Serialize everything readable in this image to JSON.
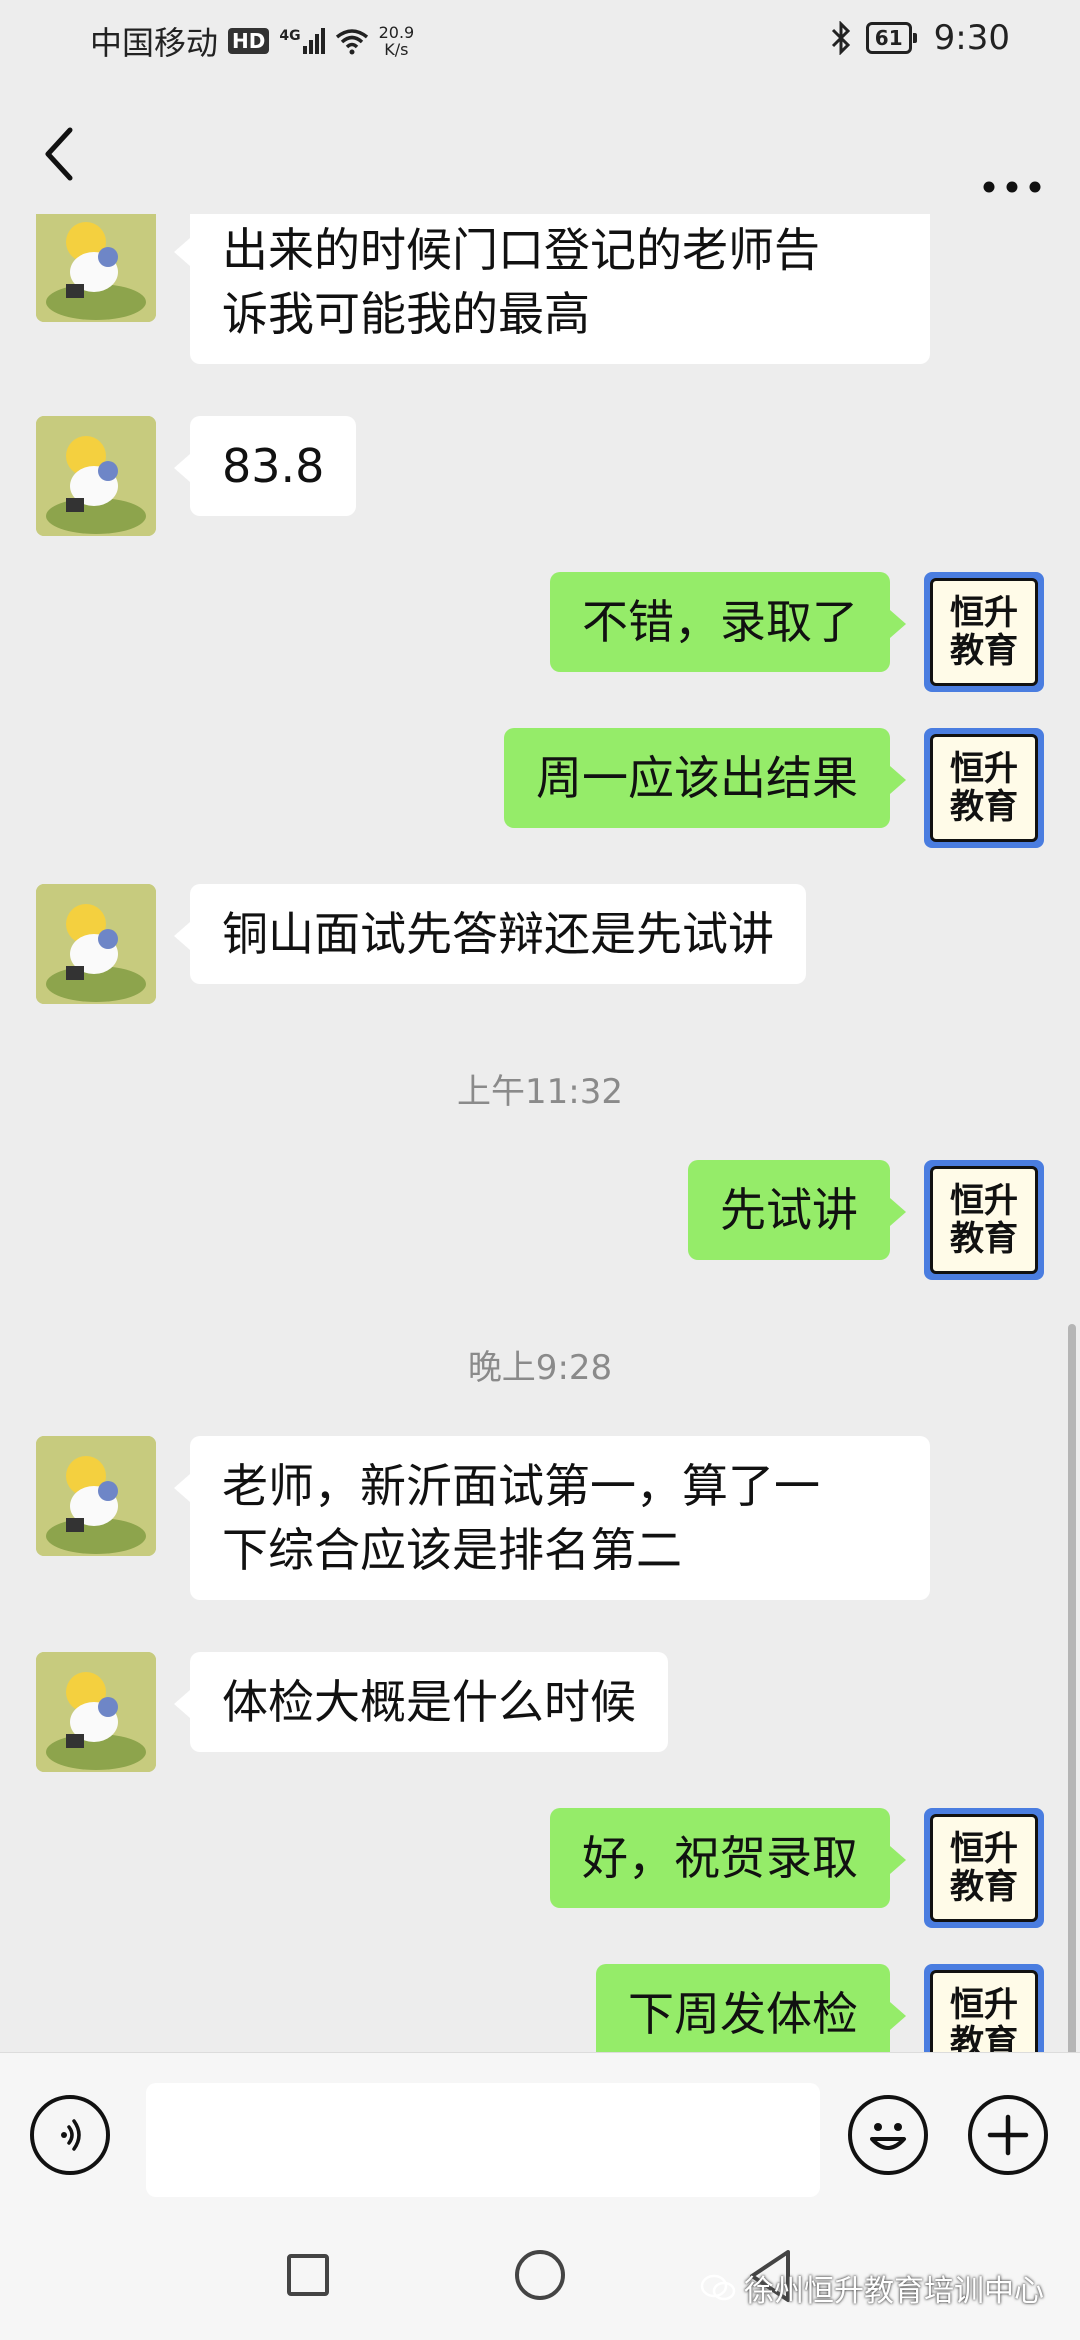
{
  "status_bar": {
    "carrier": "中国移动",
    "hd": "HD",
    "network": "4G",
    "speed_value": "20.9",
    "speed_unit": "K/s",
    "battery": "61",
    "time": "9:30"
  },
  "messages": [
    {
      "side": "left",
      "text_lines": [
        "出来的时候门口登记的老师告",
        "诉我可能我的最高"
      ]
    },
    {
      "side": "left",
      "text_lines": [
        "83.8"
      ]
    },
    {
      "side": "right",
      "text_lines": [
        "不错，录取了"
      ]
    },
    {
      "side": "right",
      "text_lines": [
        "周一应该出结果"
      ]
    },
    {
      "side": "left",
      "text_lines": [
        "铜山面试先答辩还是先试讲"
      ]
    },
    {
      "timestamp": "上午11:32"
    },
    {
      "side": "right",
      "text_lines": [
        "先试讲"
      ]
    },
    {
      "timestamp": "晚上9:28"
    },
    {
      "side": "left",
      "text_lines": [
        "老师，新沂面试第一，算了一",
        "下综合应该是排名第二"
      ]
    },
    {
      "side": "left",
      "text_lines": [
        "体检大概是什么时候"
      ]
    },
    {
      "side": "right",
      "text_lines": [
        "好，祝贺录取"
      ]
    },
    {
      "side": "right",
      "text_lines": [
        "下周发体检"
      ]
    }
  ],
  "logo_avatar": {
    "line1": "恒升",
    "line2": "教育"
  },
  "icons": {
    "back": "back-arrow-icon",
    "more": "more-icon",
    "voice": "voice-icon",
    "emoji": "emoji-icon",
    "plus": "plus-icon"
  },
  "watermark": "徐州恒升教育培训中心",
  "colors": {
    "sent_bubble": "#95ec69",
    "received_bubble": "#ffffff",
    "background": "#ededed"
  }
}
